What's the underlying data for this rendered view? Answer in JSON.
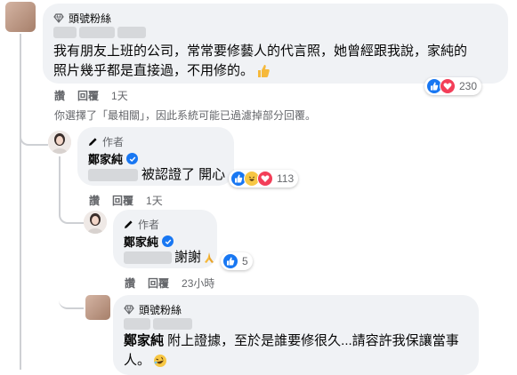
{
  "colors": {
    "link_blue": "#1877f2",
    "muted": "#65676b",
    "bubble": "#f0f2f5",
    "love_red": "#f33e58"
  },
  "comments": [
    {
      "badge": "頭號粉絲",
      "text_line1": "我有朋友上班的公司，常常要修藝人的代言照，她曾經跟我說，家純的",
      "text_line2": "照片幾乎都是直接過，不用修的。",
      "emoji_icon": "thumbs-up",
      "reactions": [
        "like",
        "love"
      ],
      "reaction_count": "230",
      "action_like": "讚",
      "action_reply": "回覆",
      "time": "1天"
    }
  ],
  "filter_notice": "你選擇了「最相關」，因此系統可能已過濾掉部分回覆。",
  "replies": [
    {
      "author_tag": "作者",
      "name": "鄭家純",
      "text": "被認證了 開心",
      "reactions": [
        "like",
        "haha",
        "love"
      ],
      "reaction_count": "113",
      "action_like": "讚",
      "action_reply": "回覆",
      "time": "1天"
    },
    {
      "author_tag": "作者",
      "name": "鄭家純",
      "text": "謝謝",
      "emoji_icon": "praying-hands",
      "reactions": [
        "like"
      ],
      "reaction_count": "5",
      "action_like": "讚",
      "action_reply": "回覆",
      "time": "23小時"
    },
    {
      "badge": "頭號粉絲",
      "mention": "鄭家純",
      "text_line1": " 附上證據，至於是誰要修很久...請容許我保讓當事",
      "text_line2": "人。",
      "emoji_icon": "rolling-laugh"
    }
  ]
}
